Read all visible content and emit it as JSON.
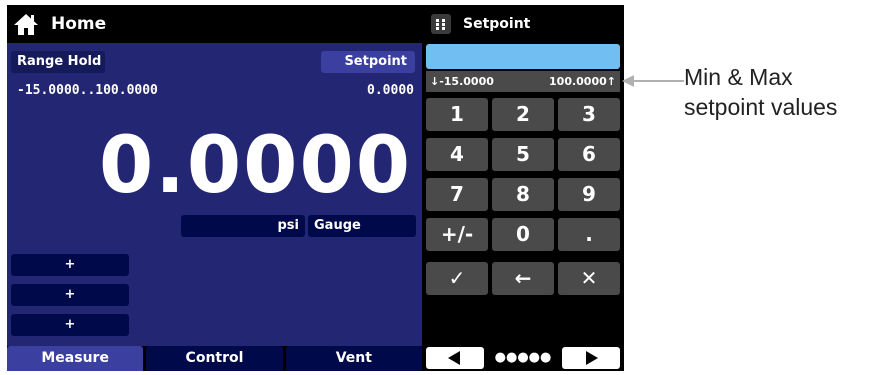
{
  "header": {
    "title": "Home"
  },
  "main": {
    "range_hold_label": "Range Hold",
    "range_values": "-15.0000..100.0000",
    "setpoint_label": "Setpoint",
    "setpoint_value": "0.0000",
    "reading": "0.0000",
    "unit": "psi",
    "mode": "Gauge",
    "plus_buttons": [
      "+",
      "+",
      "+"
    ]
  },
  "tabs": [
    "Measure",
    "Control",
    "Vent"
  ],
  "keypad": {
    "title": "Setpoint",
    "entry_value": "",
    "min_label": "↓-15.0000",
    "max_label": "100.0000↑",
    "keys": [
      "1",
      "2",
      "3",
      "4",
      "5",
      "6",
      "7",
      "8",
      "9",
      "+/-",
      "0",
      "."
    ],
    "ok": "✓",
    "backspace": "←",
    "cancel": "✕",
    "page_dots": "●●●●●"
  },
  "annotation": {
    "line1": "Min & Max",
    "line2": "setpoint values"
  },
  "colors": {
    "panel": "#232673",
    "entry": "#71bff2",
    "key": "#4a4a4a"
  }
}
